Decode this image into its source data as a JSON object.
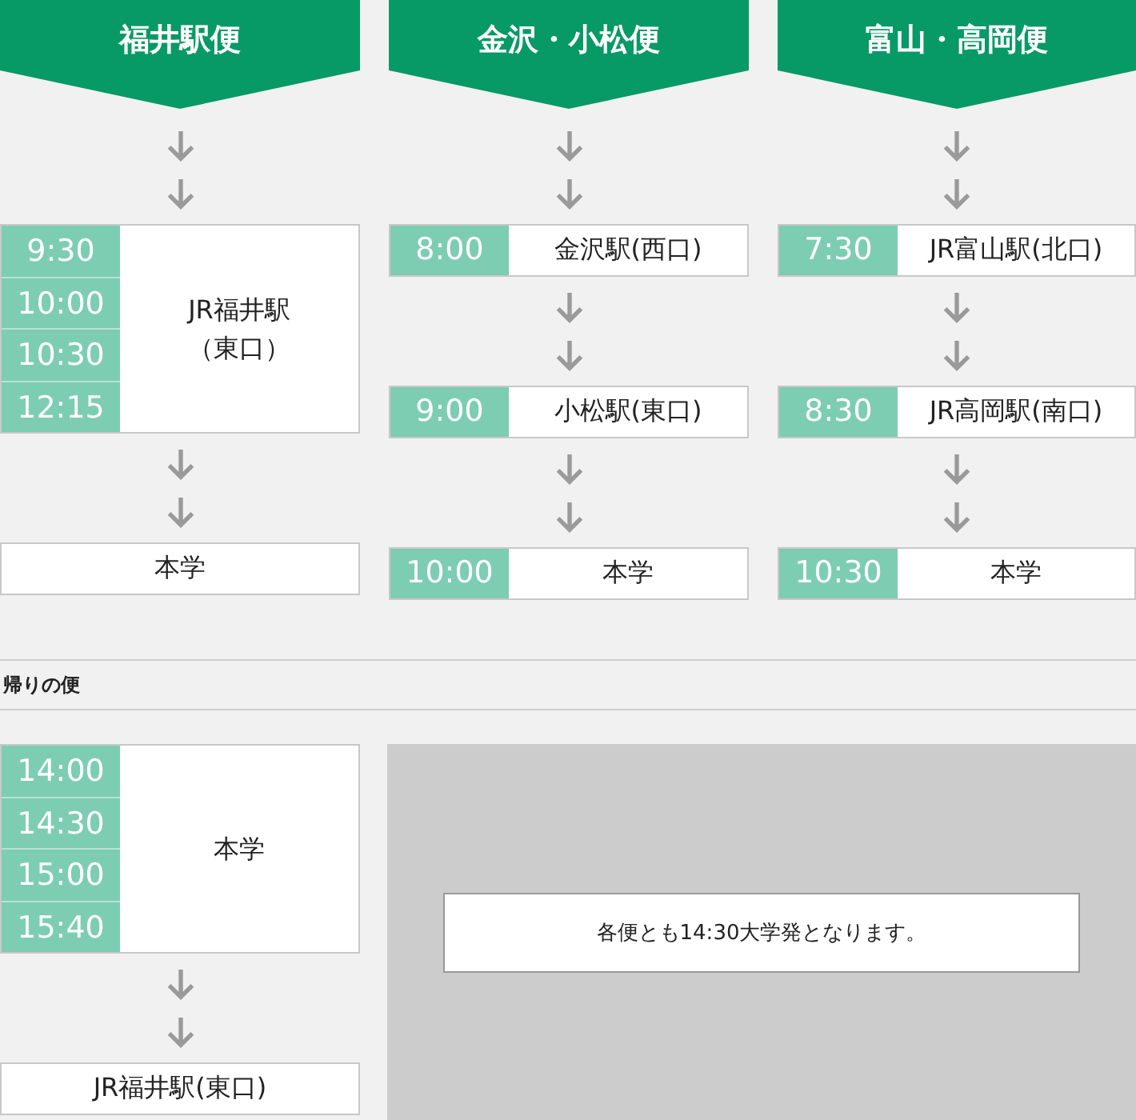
{
  "routes": [
    {
      "title": "福井駅便",
      "steps": [
        {
          "kind": "arrow"
        },
        {
          "kind": "arrow"
        },
        {
          "kind": "stop",
          "times": [
            "9:30",
            "10:00",
            "10:30",
            "12:15"
          ],
          "station": "JR福井駅（東口）"
        },
        {
          "kind": "arrow"
        },
        {
          "kind": "arrow"
        },
        {
          "kind": "stop",
          "station": "本学"
        }
      ]
    },
    {
      "title": "金沢・小松便",
      "steps": [
        {
          "kind": "arrow"
        },
        {
          "kind": "arrow"
        },
        {
          "kind": "stop",
          "times": [
            "8:00"
          ],
          "station": "金沢駅(西口)"
        },
        {
          "kind": "arrow"
        },
        {
          "kind": "arrow"
        },
        {
          "kind": "stop",
          "times": [
            "9:00"
          ],
          "station": "小松駅(東口)"
        },
        {
          "kind": "arrow"
        },
        {
          "kind": "arrow"
        },
        {
          "kind": "stop",
          "times": [
            "10:00"
          ],
          "station": "本学"
        }
      ]
    },
    {
      "title": "富山・高岡便",
      "steps": [
        {
          "kind": "arrow"
        },
        {
          "kind": "arrow"
        },
        {
          "kind": "stop",
          "times": [
            "7:30"
          ],
          "station": "JR富山駅(北口)"
        },
        {
          "kind": "arrow"
        },
        {
          "kind": "arrow"
        },
        {
          "kind": "stop",
          "times": [
            "8:30"
          ],
          "station": "JR高岡駅(南口)"
        },
        {
          "kind": "arrow"
        },
        {
          "kind": "arrow"
        },
        {
          "kind": "stop",
          "times": [
            "10:30"
          ],
          "station": "本学"
        }
      ]
    }
  ],
  "return": {
    "heading": "帰りの便",
    "steps": [
      {
        "kind": "stop",
        "times": [
          "14:00",
          "14:30",
          "15:00",
          "15:40"
        ],
        "station": "本学"
      },
      {
        "kind": "arrow"
      },
      {
        "kind": "arrow"
      },
      {
        "kind": "stop",
        "station": "JR福井駅(東口)"
      }
    ],
    "note": "各便とも14:30大学発となります。"
  }
}
